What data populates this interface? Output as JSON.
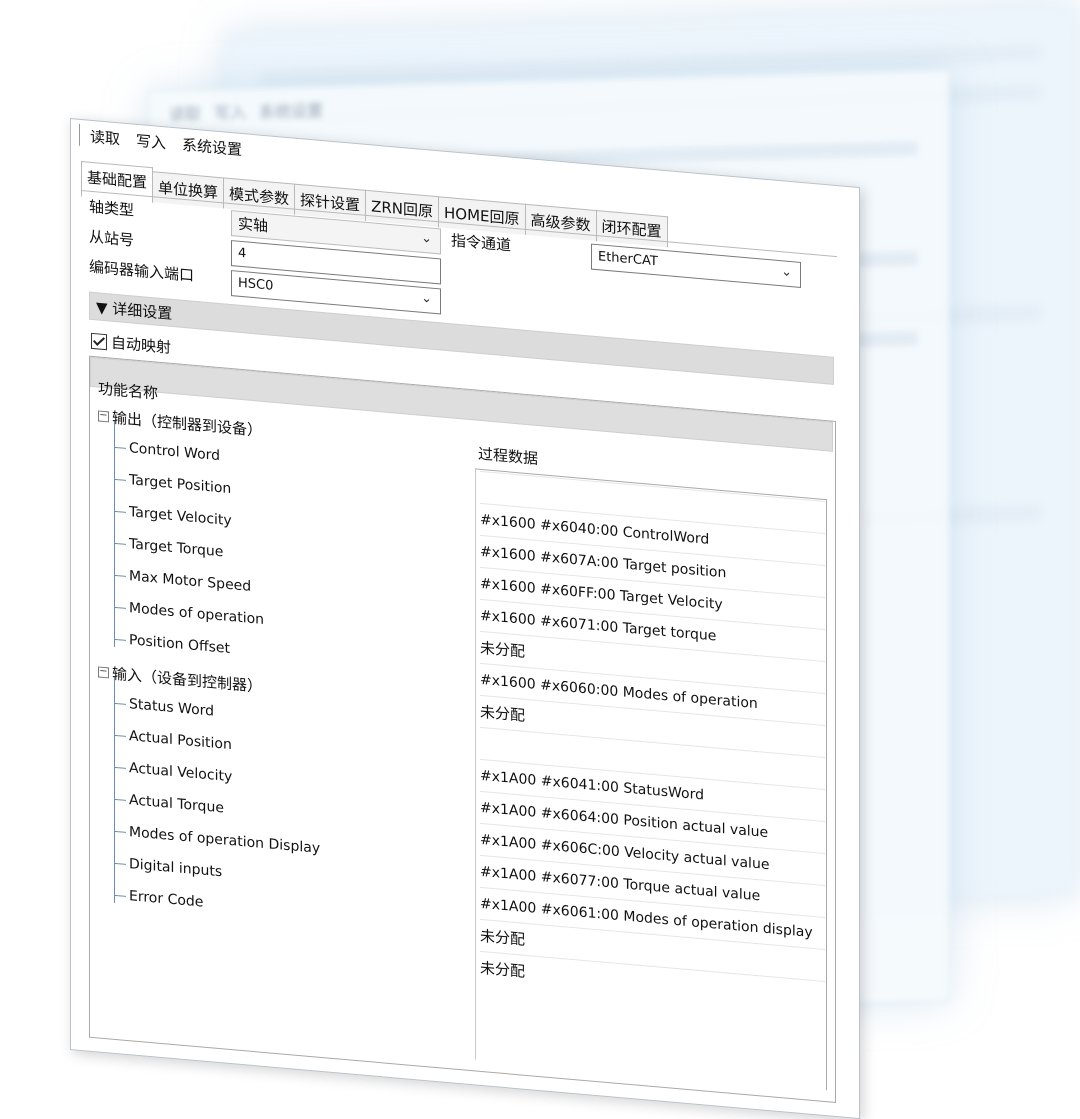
{
  "menu": {
    "read": "读取",
    "write": "写入",
    "system_settings": "系统设置"
  },
  "tabs": [
    "基础配置",
    "单位换算",
    "模式参数",
    "探针设置",
    "ZRN回原",
    "HOME回原",
    "高级参数",
    "闭环配置"
  ],
  "active_tab_index": 0,
  "form": {
    "axis_type_label": "轴类型",
    "axis_type_value": "实轴",
    "slave_label": "从站号",
    "slave_value": "4",
    "encoder_label": "编码器输入端口",
    "encoder_value": "HSC0",
    "channel_label": "指令通道",
    "channel_value": "EtherCAT"
  },
  "details": {
    "toggle": "▼ 详细设置",
    "auto_map_label": "自动映射",
    "auto_map_checked": true
  },
  "tree": {
    "column_name": "功能名称",
    "column_data": "过程数据",
    "groups": [
      {
        "label": "输出（控制器到设备）",
        "items": [
          "Control Word",
          "Target Position",
          "Target Velocity",
          "Target Torque",
          "Max Motor Speed",
          "Modes of operation",
          "Position Offset"
        ]
      },
      {
        "label": "输入（设备到控制器）",
        "items": [
          "Status Word",
          "Actual Position",
          "Actual Velocity",
          "Actual Torque",
          "Modes of operation Display",
          "Digital inputs",
          "Error Code"
        ]
      }
    ],
    "values": [
      "",
      "#x1600 #x6040:00 ControlWord",
      "#x1600 #x607A:00 Target position",
      "#x1600 #x60FF:00 Target Velocity",
      "#x1600 #x6071:00 Target torque",
      "未分配",
      "#x1600 #x6060:00 Modes of operation",
      "未分配",
      "",
      "#x1A00 #x6041:00 StatusWord",
      "#x1A00 #x6064:00 Position actual value",
      "#x1A00 #x606C:00 Velocity actual value",
      "#x1A00 #x6077:00 Torque actual value",
      "#x1A00 #x6061:00 Modes of operation display",
      "未分配",
      "未分配"
    ]
  },
  "background": {
    "read": "读取",
    "write": "写入",
    "system_settings": "系统设置"
  }
}
